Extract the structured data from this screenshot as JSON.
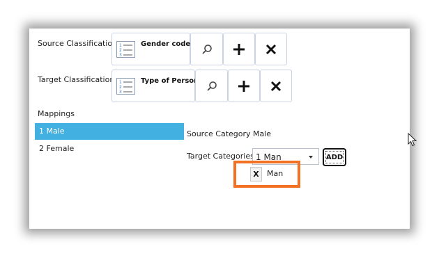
{
  "source_classification": {
    "label": "Source Classification",
    "selected": "Gender codes"
  },
  "target_classification": {
    "label": "Target Classification",
    "selected": "Type of Person"
  },
  "mappings": {
    "heading": "Mappings",
    "items": [
      {
        "label": "1 Male",
        "selected": true
      },
      {
        "label": "2 Female",
        "selected": false
      }
    ]
  },
  "detail": {
    "source_category_label": "Source Category",
    "source_category_value": "Male",
    "target_categories_label": "Target Categories",
    "target_select_value": "1 Man",
    "add_label": "ADD",
    "tags": [
      {
        "remove": "X",
        "label": "Man"
      }
    ]
  },
  "colors": {
    "selected_row": "#42b0e0",
    "highlight": "#f37123",
    "button_border": "#c9d3e4"
  },
  "icons": {
    "classification": "numbered-list-icon",
    "search": "search-icon",
    "add": "plus-icon",
    "clear": "close-icon",
    "cursor": "mouse-pointer-icon"
  }
}
